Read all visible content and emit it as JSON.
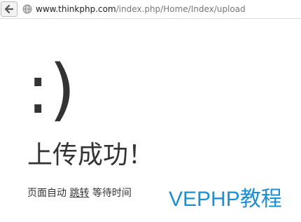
{
  "browser": {
    "url_domain": "www.thinkphp.com",
    "url_path": "/index.php/Home/Index/upload"
  },
  "page": {
    "smiley": ":)",
    "title": "上传成功！",
    "jump_prefix": "页面自动",
    "jump_link_label": "跳转",
    "jump_suffix": "等待时间"
  },
  "watermark": {
    "text": "VEPHP教程",
    "color": "#1e8fd0"
  },
  "icons": {
    "back": "back-arrow-icon",
    "site": "globe-icon"
  }
}
